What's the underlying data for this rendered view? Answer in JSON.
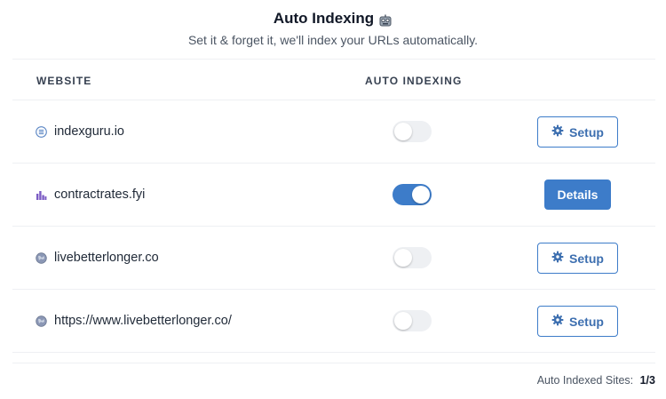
{
  "header": {
    "title": "Auto Indexing",
    "title_icon": "robot-icon",
    "subtitle": "Set it & forget it, we'll index your URLs automatically."
  },
  "table": {
    "columns": [
      "WEBSITE",
      "AUTO INDEXING"
    ],
    "rows": [
      {
        "site": "indexguru.io",
        "icon": "list-circle-icon",
        "auto_indexing": false,
        "action": "Setup",
        "action_icon": "gear-icon"
      },
      {
        "site": "contractrates.fyi",
        "icon": "bar-chart-icon",
        "auto_indexing": true,
        "action": "Details"
      },
      {
        "site": "livebetterlonger.co",
        "icon": "globe-icon",
        "auto_indexing": false,
        "action": "Setup",
        "action_icon": "gear-icon"
      },
      {
        "site": "https://www.livebetterlonger.co/",
        "icon": "globe-icon",
        "auto_indexing": false,
        "action": "Setup",
        "action_icon": "gear-icon"
      }
    ]
  },
  "footer": {
    "label": "Auto Indexed Sites:",
    "count": "1/3"
  },
  "colors": {
    "accent": "#3d7cc9",
    "toggle_off": "#eef0f3"
  }
}
